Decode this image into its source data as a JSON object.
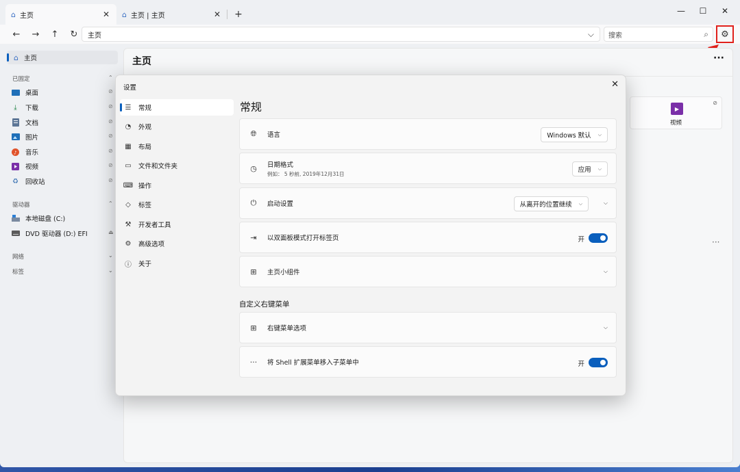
{
  "tabs": [
    {
      "label": "主页",
      "close": "✕"
    },
    {
      "label": "主页 | 主页",
      "close": "✕"
    }
  ],
  "newtab": "+",
  "window_controls": {
    "minimize": "—",
    "maximize": "☐",
    "close": "✕"
  },
  "address": {
    "path": "主页",
    "chevron": "⌵"
  },
  "search": {
    "placeholder": "搜索",
    "icon": "⌕"
  },
  "sidebar": {
    "home": "主页",
    "pinned_header": "已固定",
    "pinned": [
      {
        "label": "桌面",
        "icon": "desktop-icon"
      },
      {
        "label": "下载",
        "icon": "download-icon"
      },
      {
        "label": "文档",
        "icon": "document-icon"
      },
      {
        "label": "图片",
        "icon": "pictures-icon"
      },
      {
        "label": "音乐",
        "icon": "music-icon"
      },
      {
        "label": "视频",
        "icon": "video-icon"
      },
      {
        "label": "回收站",
        "icon": "recycle-bin-icon"
      }
    ],
    "drives_header": "驱动器",
    "drives": [
      {
        "label": "本地磁盘 (C:)"
      },
      {
        "label": "DVD 驱动器 (D:) EFI"
      }
    ],
    "network_header": "网络",
    "tags_header": "标签"
  },
  "main": {
    "title": "主页",
    "more": "···",
    "video_card_label": "视频",
    "dots": "···"
  },
  "dialog": {
    "title": "设置",
    "close": "✕",
    "nav": [
      {
        "label": "常规"
      },
      {
        "label": "外观"
      },
      {
        "label": "布局"
      },
      {
        "label": "文件和文件夹"
      },
      {
        "label": "操作"
      },
      {
        "label": "标签"
      },
      {
        "label": "开发者工具"
      },
      {
        "label": "高级选项"
      },
      {
        "label": "关于"
      }
    ],
    "content_title": "常规",
    "cards": {
      "language": {
        "label": "语言",
        "value": "Windows 默认"
      },
      "date": {
        "label": "日期格式",
        "sub": "例如： 5 秒前, 2019年12月31日",
        "value": "应用"
      },
      "startup": {
        "label": "启动设置",
        "value": "从离开的位置继续"
      },
      "dual_pane": {
        "label": "以双面板模式打开标签页",
        "toggle_label": "开",
        "on": true
      },
      "widgets": {
        "label": "主页小组件"
      },
      "context_header": "自定义右键菜单",
      "context_options": {
        "label": "右键菜单选项"
      },
      "shell_move": {
        "label": "将 Shell 扩展菜单移入子菜单中",
        "toggle_label": "开",
        "on": true
      }
    }
  },
  "colors": {
    "accent": "#0a5fbd",
    "highlight": "#e0201b"
  }
}
